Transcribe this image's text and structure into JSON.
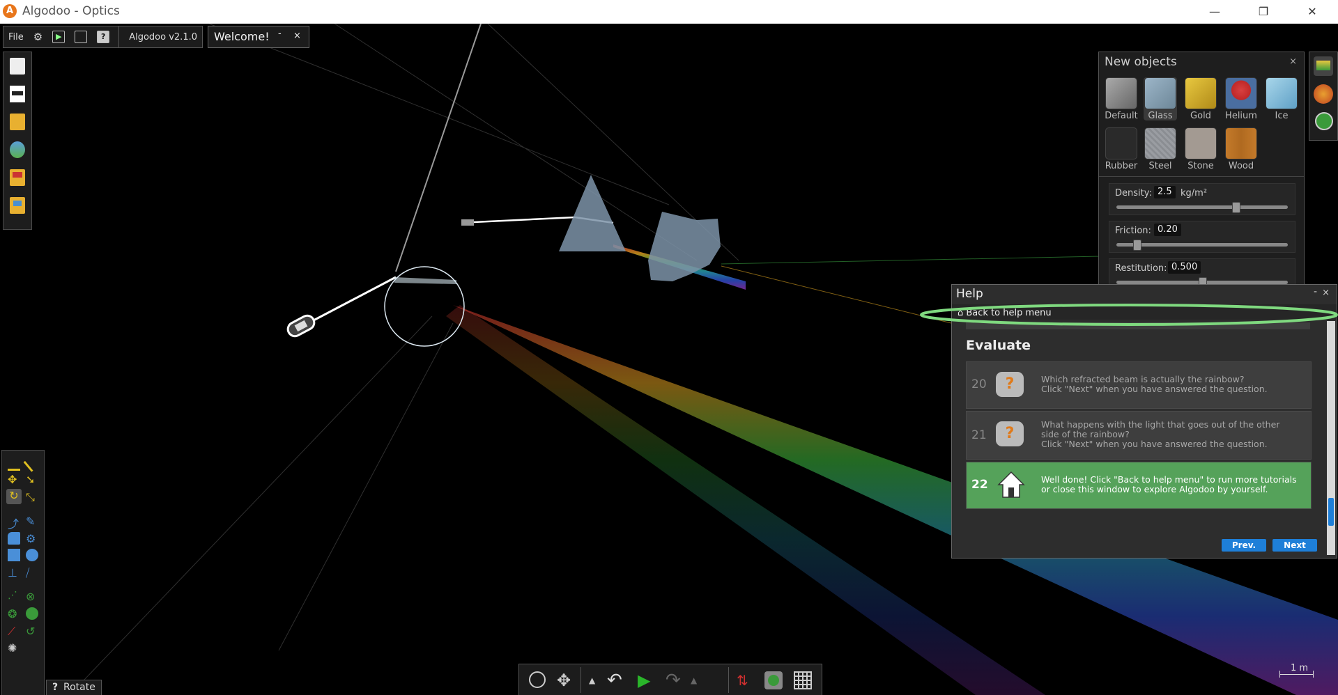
{
  "window": {
    "title": "Algodoo - Optics",
    "logo": "A",
    "minimize": "—",
    "restore": "❐",
    "close": "✕"
  },
  "topbar": {
    "file_label": "File",
    "version_label": "Algodoo v2.1.0",
    "settings_icon": "gear-icon",
    "play_icon": "play-icon",
    "window_icon": "window-icon",
    "help_icon": "help-icon",
    "help_glyph": "?"
  },
  "welcome_tab": {
    "label": "Welcome!",
    "minimize": "-",
    "close": "×"
  },
  "left_toolbar": {
    "items": [
      "new-scene-icon",
      "blank-scene-icon",
      "open-folder-icon",
      "browse-scenes-icon",
      "sample-scenes-icon",
      "open-lessons-icon"
    ]
  },
  "tools_palette": {
    "items": [
      "sketch-tool",
      "knife-tool",
      "move-tool",
      "drag-tool",
      "rotate-tool",
      "scale-tool",
      "chain-tool",
      "pen-tool",
      "brush-tool",
      "gear-tool",
      "box-tool",
      "circle-tool",
      "plane-tool",
      "spring-tool",
      "fixate-tool",
      "hinge-tool",
      "axle-tool",
      "thruster-tool",
      "laser-tool",
      "tracer-tool",
      "spiral-tool"
    ]
  },
  "rotate_tooltip": {
    "glyph": "?",
    "label": "Rotate"
  },
  "new_objects": {
    "title": "New objects",
    "close": "×",
    "materials": [
      {
        "name": "Default",
        "color": "#8a8a8a"
      },
      {
        "name": "Glass",
        "color": "#7d97a8"
      },
      {
        "name": "Gold",
        "color": "#d1a82a"
      },
      {
        "name": "Helium",
        "color": "#c94040"
      },
      {
        "name": "Ice",
        "color": "#7fb8d6"
      },
      {
        "name": "Rubber",
        "color": "#2a2a2a"
      },
      {
        "name": "Steel",
        "color": "#9a9da2"
      },
      {
        "name": "Stone",
        "color": "#a39a92"
      },
      {
        "name": "Wood",
        "color": "#c47a2a"
      }
    ],
    "selected_material": "Glass",
    "density": {
      "label": "Density:",
      "value": "2.5",
      "unit": "kg/m²",
      "level": 0.7
    },
    "friction": {
      "label": "Friction:",
      "value": "0.20",
      "level": 0.1
    },
    "restitution": {
      "label": "Restitution:",
      "value": "0.500",
      "level": 0.5
    }
  },
  "right_dock": {
    "items": [
      "new-objects-icon",
      "palette-icon",
      "add-scene-icon"
    ]
  },
  "help": {
    "title": "Help",
    "minimize": "-",
    "close": "×",
    "back_link": "Back to help menu",
    "section": "Evaluate",
    "steps": [
      {
        "num": "20",
        "text": "Which refracted beam is actually the rainbow?\nClick \"Next\" when you have answered the question."
      },
      {
        "num": "21",
        "text": "What happens with the light that goes out of the other\nside of the rainbow?\nClick \"Next\" when you have answered the question."
      },
      {
        "num": "22",
        "text": "Well done! Click \"Back to help menu\" to run more tutorials\nor close this window to explore Algodoo by yourself."
      }
    ],
    "question_glyph": "?",
    "prev_label": "Prev.",
    "next_label": "Next",
    "highlight_color": "#7fd97f"
  },
  "bottom_toolbar": {
    "items": [
      "zoom-icon",
      "pan-icon",
      "undo-menu-icon",
      "undo-icon",
      "play-icon",
      "redo-icon",
      "redo-menu-icon",
      "gravity-icon",
      "air-friction-icon",
      "grid-icon"
    ],
    "play_color": "#2ab52a"
  },
  "scale_bar": {
    "label": "1 m"
  }
}
